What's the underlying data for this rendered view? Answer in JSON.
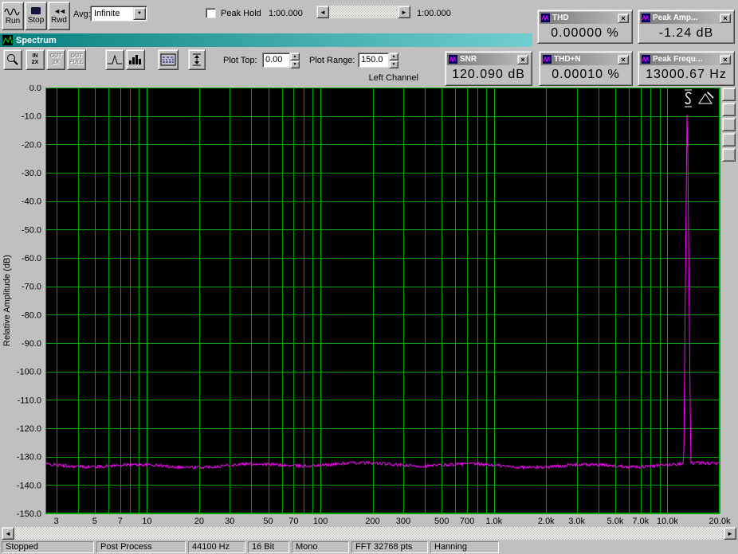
{
  "glyphs": {
    "close": "×",
    "left": "◄",
    "right": "►",
    "up": "▲",
    "down": "▼",
    "rewind": "◄◄"
  },
  "transport": {
    "run": "Run",
    "stop": "Stop",
    "rwd": "Rwd",
    "avg_label": "Avg:",
    "avg_value": "Infinite",
    "peak_hold": "Peak Hold",
    "time_elapsed": "1:00.000",
    "time_total": "1:00.000"
  },
  "spectrum_window": {
    "title": "Spectrum"
  },
  "plot_toolbar": {
    "plot_top_label": "Plot Top:",
    "plot_top_value": "0.00",
    "plot_range_label": "Plot Range:",
    "plot_range_value": "150.0",
    "channel": "Left Channel",
    "zoom_buttons": {
      "in_2x": [
        "IN",
        "2X"
      ],
      "out_2x": [
        "OUT",
        "2X"
      ],
      "out_full": [
        "OUT",
        "FULL"
      ]
    }
  },
  "meters": {
    "thd": {
      "title": "THD",
      "value": "0.00000 %"
    },
    "peak_amp": {
      "title": "Peak Amp...",
      "value": "-1.24 dB"
    },
    "snr": {
      "title": "SNR",
      "value": "120.090 dB"
    },
    "thd_n": {
      "title": "THD+N",
      "value": "0.00010 %"
    },
    "peak_freq": {
      "title": "Peak Frequ...",
      "value": "13000.67 Hz"
    }
  },
  "statusbar": {
    "cells": [
      "Stopped",
      "Post Process",
      "44100 Hz",
      "16 Bit",
      "Mono",
      "FFT 32768 pts",
      "Hanning"
    ]
  },
  "chart_data": {
    "type": "line",
    "x_scale": "log",
    "xlim": [
      2.6,
      20000
    ],
    "ylim": [
      -150,
      0
    ],
    "ylabel": "Relative Amplitude (dB)",
    "y_tick_labels": [
      "0.0",
      "-10.0",
      "-20.0",
      "-30.0",
      "-40.0",
      "-50.0",
      "-60.0",
      "-70.0",
      "-80.0",
      "-90.0",
      "-100.0",
      "-110.0",
      "-120.0",
      "-130.0",
      "-140.0",
      "-150.0"
    ],
    "x_ticks": [
      {
        "f": 3,
        "label": "3"
      },
      {
        "f": 5,
        "label": "5"
      },
      {
        "f": 7,
        "label": "7"
      },
      {
        "f": 10,
        "label": "10"
      },
      {
        "f": 20,
        "label": "20"
      },
      {
        "f": 30,
        "label": "30"
      },
      {
        "f": 50,
        "label": "50"
      },
      {
        "f": 70,
        "label": "70"
      },
      {
        "f": 100,
        "label": "100"
      },
      {
        "f": 200,
        "label": "200"
      },
      {
        "f": 300,
        "label": "300"
      },
      {
        "f": 500,
        "label": "500"
      },
      {
        "f": 700,
        "label": "700"
      },
      {
        "f": 1000,
        "label": "1.0k"
      },
      {
        "f": 2000,
        "label": "2.0k"
      },
      {
        "f": 3000,
        "label": "3.0k"
      },
      {
        "f": 5000,
        "label": "5.0k"
      },
      {
        "f": 7000,
        "label": "7.0k"
      },
      {
        "f": 10000,
        "label": "10.0k"
      },
      {
        "f": 20000,
        "label": "20.0k"
      }
    ],
    "grid": true,
    "legend": "none",
    "series": [
      {
        "name": "left-channel-spectrum",
        "noise_floor_db": -133,
        "noise_ripple_db": 1.1,
        "peak": {
          "freq_hz": 13000.67,
          "amplitude_db": -1.24
        }
      }
    ],
    "colors": {
      "bg": "#000000",
      "grid": "#00a000",
      "grid_major": "#00b400",
      "trace": "#ff00ff"
    }
  }
}
